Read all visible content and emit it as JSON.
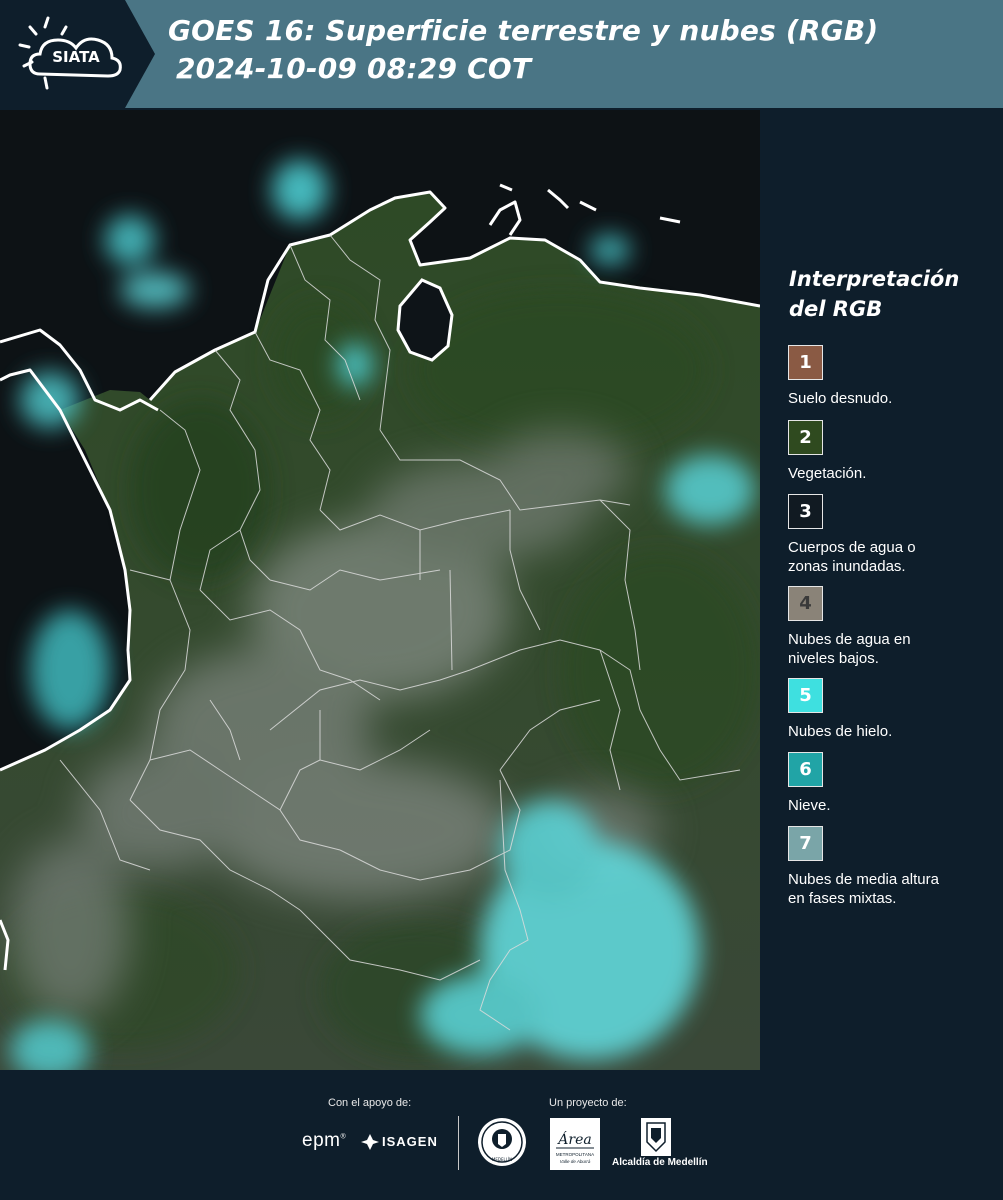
{
  "header": {
    "logo_text": "SIATA",
    "title_line1": "GOES 16: Superficie terrestre y nubes (RGB)",
    "title_line2": "2024-10-09 08:29 COT"
  },
  "legend": {
    "title_line1": "Interpretación",
    "title_line2": "del RGB",
    "items": [
      {
        "number": "1",
        "label_line1": "Suelo desnudo.",
        "label_line2": "",
        "color": "#8a5a44",
        "text_color": "#ffffff"
      },
      {
        "number": "2",
        "label_line1": "Vegetación.",
        "label_line2": "",
        "color": "#2f4a1f",
        "text_color": "#ffffff"
      },
      {
        "number": "3",
        "label_line1": "Cuerpos de agua o",
        "label_line2": "zonas inundadas.",
        "color": "#111a22",
        "text_color": "#ffffff"
      },
      {
        "number": "4",
        "label_line1": "Nubes de agua en",
        "label_line2": "niveles bajos.",
        "color": "#8a8378",
        "text_color": "#3a3a3a"
      },
      {
        "number": "5",
        "label_line1": "Nubes de hielo.",
        "label_line2": "",
        "color": "#3ee0e0",
        "text_color": "#ffffff"
      },
      {
        "number": "6",
        "label_line1": "Nieve.",
        "label_line2": "",
        "color": "#21a4a6",
        "text_color": "#ffffff"
      },
      {
        "number": "7",
        "label_line1": "Nubes de media altura",
        "label_line2": "en fases mixtas.",
        "color": "#7aa5a8",
        "text_color": "#ffffff"
      }
    ]
  },
  "footer": {
    "support_label": "Con el apoyo de:",
    "project_label": "Un proyecto de:",
    "sponsor1": "epm",
    "sponsor2": "ISAGEN",
    "partner_area": "Área",
    "partner_area_sub1": "METROPOLITANA",
    "partner_area_sub2": "Valle de Aburrá",
    "partner_alcaldia": "Alcaldía de Medellín",
    "seal_text": "MEDELLÍN"
  },
  "colors": {
    "header_bg": "#4a7585",
    "page_bg": "#0e1e2b",
    "ocean": "#0d1215",
    "vegetation": "#2f4a24",
    "ice_clouds": "#4fd8dc"
  }
}
